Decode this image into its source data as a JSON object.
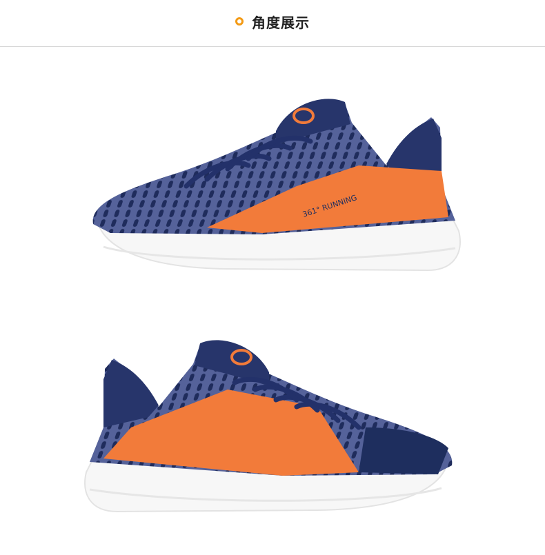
{
  "header": {
    "title": "角度展示",
    "ring_icon": "circle-outline-icon"
  },
  "products": [
    {
      "name": "running-shoe-side-view",
      "brand_text": "361° RUNNING"
    },
    {
      "name": "running-shoe-mirrored-view"
    }
  ],
  "colors": {
    "accent": "#f39a14",
    "upper_navy": "#3d4a7c",
    "trim_navy": "#1e2e5e",
    "panel_orange": "#f27b3a",
    "sole_white": "#ffffff"
  }
}
